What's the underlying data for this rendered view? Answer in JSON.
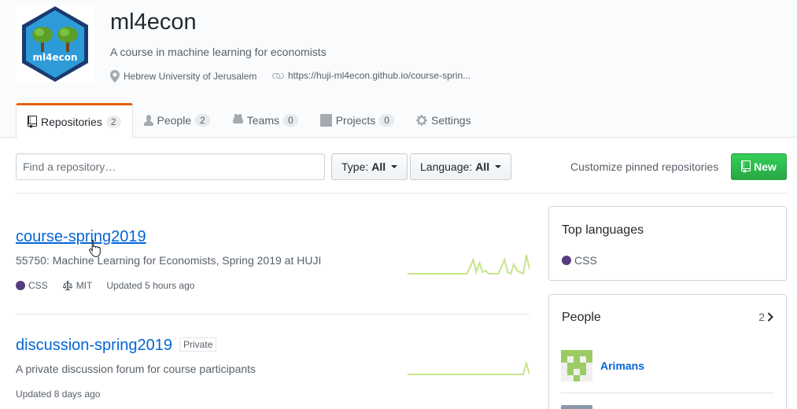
{
  "org": {
    "name": "ml4econ",
    "avatar_label": "ml4econ",
    "description": "A course in machine learning for economists",
    "location": "Hebrew University of Jerusalem",
    "website": "https://huji-ml4econ.github.io/course-sprin..."
  },
  "tabs": [
    {
      "label": "Repositories",
      "count": "2",
      "icon": "repo-icon"
    },
    {
      "label": "People",
      "count": "2",
      "icon": "person-icon"
    },
    {
      "label": "Teams",
      "count": "0",
      "icon": "jersey-icon"
    },
    {
      "label": "Projects",
      "count": "0",
      "icon": "project-icon"
    },
    {
      "label": "Settings",
      "icon": "gear-icon"
    }
  ],
  "filters": {
    "search_placeholder": "Find a repository…",
    "type_label": "Type:",
    "type_value": "All",
    "language_label": "Language:",
    "language_value": "All",
    "customize_label": "Customize pinned repositories",
    "new_label": "New"
  },
  "repos": [
    {
      "name": "course-spring2019",
      "description": "55750: Machine Learning for Economists, Spring 2019 at HUJI",
      "language": "CSS",
      "license": "MIT",
      "updated": "Updated 5 hours ago",
      "activity": [
        0,
        0,
        0,
        0,
        0,
        0,
        0,
        0,
        0,
        0,
        0,
        0,
        0,
        0,
        0,
        0,
        0,
        0,
        0,
        0,
        4,
        9,
        1,
        7,
        1,
        2,
        0,
        0,
        0,
        0,
        4,
        9,
        1,
        0,
        6,
        2,
        1,
        0,
        12,
        3
      ]
    },
    {
      "name": "discussion-spring2019",
      "label": "Private",
      "description": "A private discussion forum for course participants",
      "updated": "Updated 8 days ago",
      "activity": [
        0,
        0,
        0,
        0,
        0,
        0,
        0,
        0,
        0,
        0,
        0,
        0,
        0,
        0,
        0,
        0,
        0,
        0,
        0,
        0,
        0,
        0,
        0,
        0,
        0,
        0,
        0,
        0,
        0,
        0,
        0,
        0,
        0,
        0,
        0,
        0,
        0,
        0,
        1,
        0
      ]
    }
  ],
  "sidebar": {
    "top_languages_title": "Top languages",
    "top_language": "CSS",
    "people_title": "People",
    "people_count": "2",
    "people": [
      {
        "name": "Arimans"
      }
    ]
  },
  "colors": {
    "accent": "#0366d6",
    "tab_border": "#e36209",
    "css_lang": "#563d7c",
    "new_button": "#28a745",
    "sparkline": "#c6e48b"
  }
}
